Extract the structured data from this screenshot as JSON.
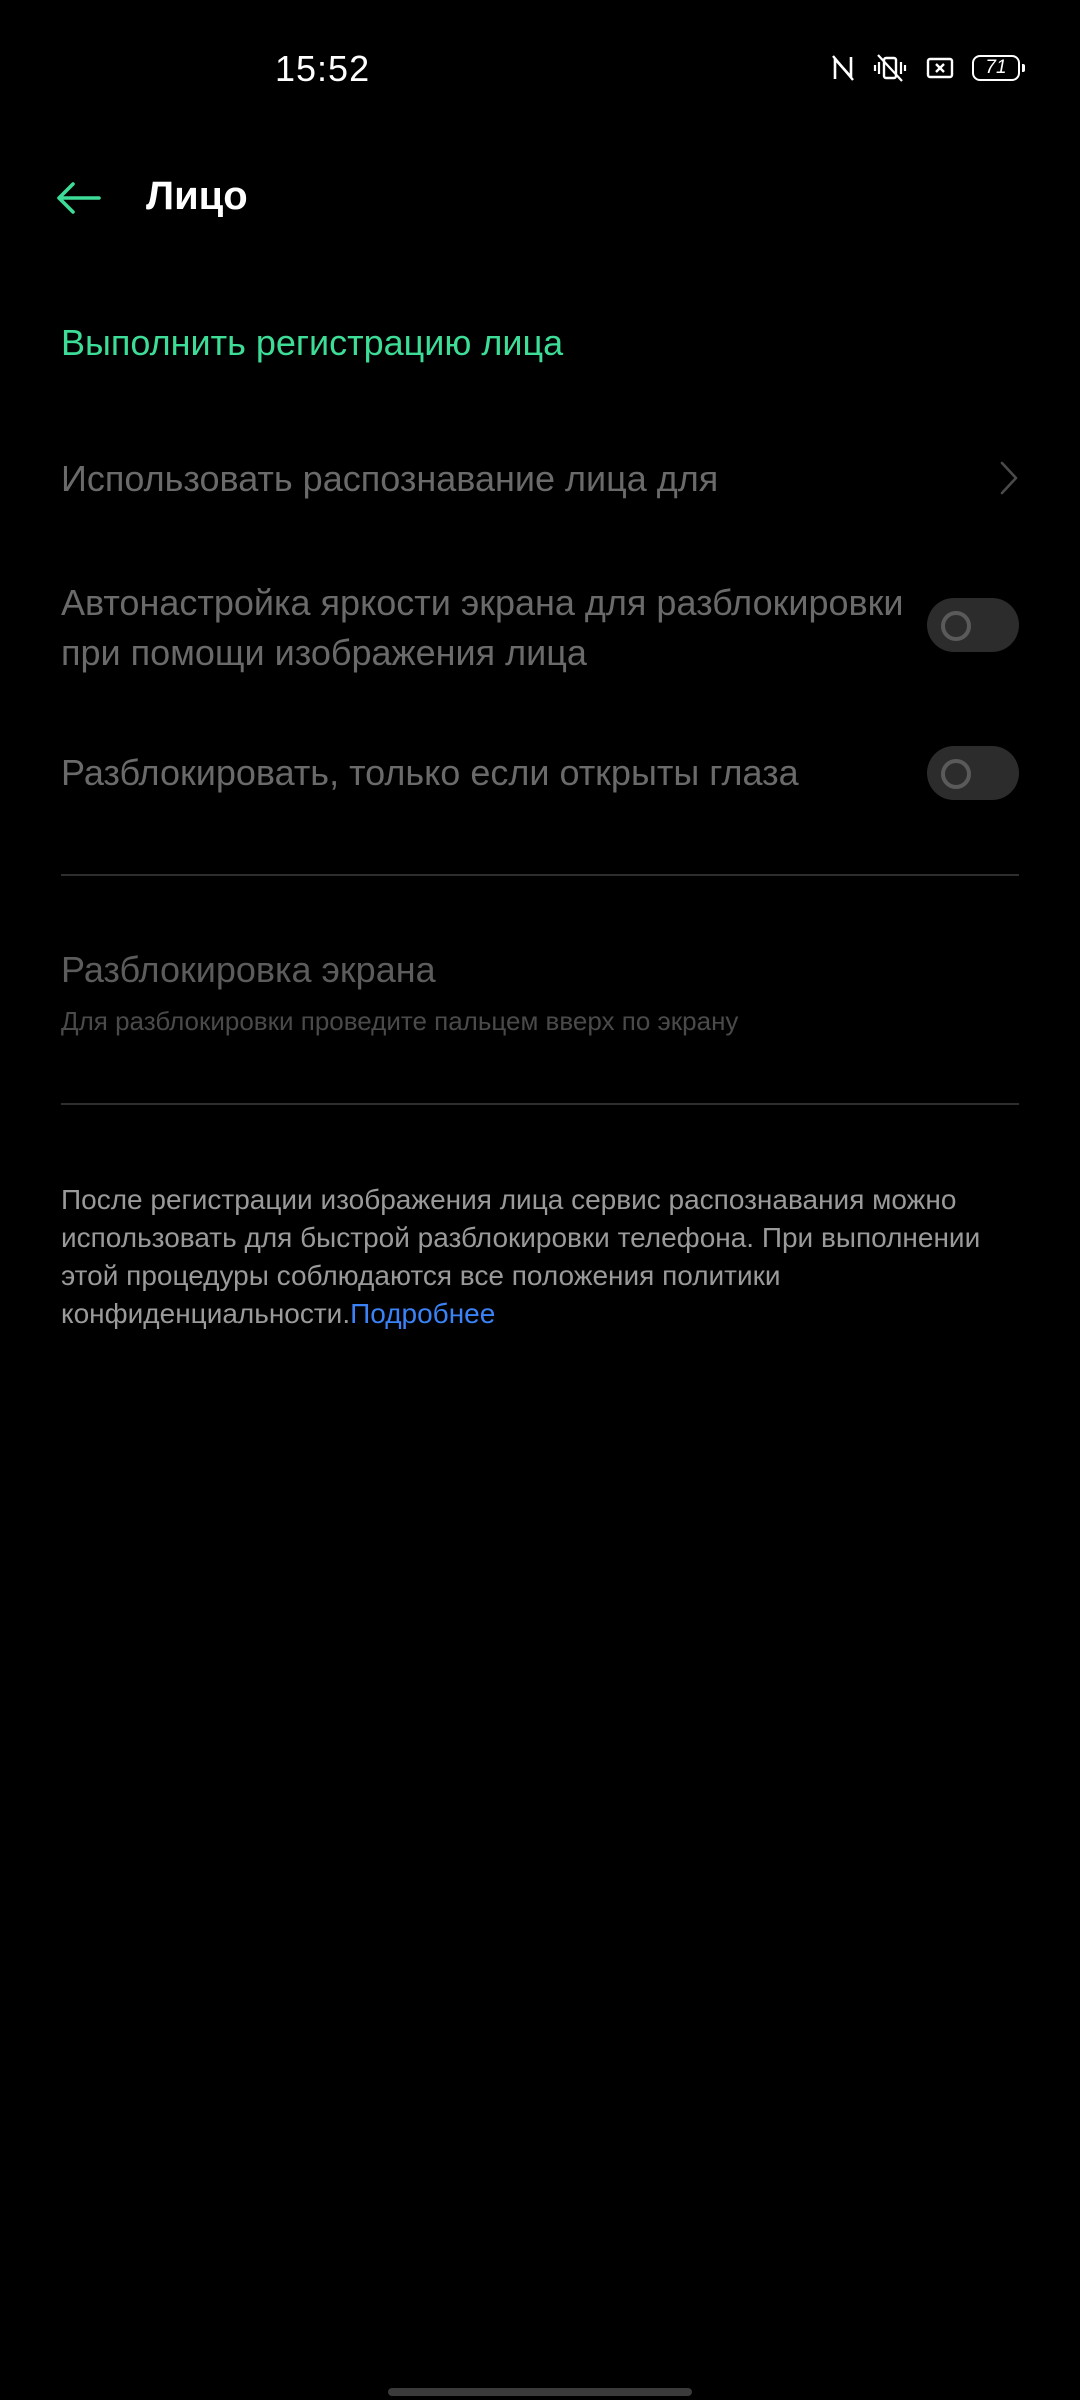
{
  "status_bar": {
    "time": "15:52",
    "battery": "71",
    "icons": [
      "nfc-icon",
      "vibrate-icon",
      "screenshot-icon",
      "battery-icon"
    ]
  },
  "header": {
    "title": "Лицо",
    "back_icon": "arrow-left-icon"
  },
  "colors": {
    "accent": "#3ddc97",
    "link": "#3b82f6",
    "background": "#000000"
  },
  "main": {
    "register_label": "Выполнить регистрацию лица",
    "use_face_label": "Использовать распознавание лица для",
    "brightness_label": "Автонастройка яркости экрана для разблокировки при помощи изображения лица",
    "brightness_enabled": false,
    "eyes_label": "Разблокировать, только если открыты глаза",
    "eyes_enabled": false,
    "screen_unlock_title": "Разблокировка экрана",
    "screen_unlock_subtitle": "Для разблокировки проведите пальцем вверх по экрану",
    "info_text": "После регистрации изображения лица сервис распознавания можно использовать для быстрой разблокировки телефона. При выполнении этой процедуры соблюдаются все положения политики конфиденциальности.",
    "info_link": "Подробнее"
  }
}
